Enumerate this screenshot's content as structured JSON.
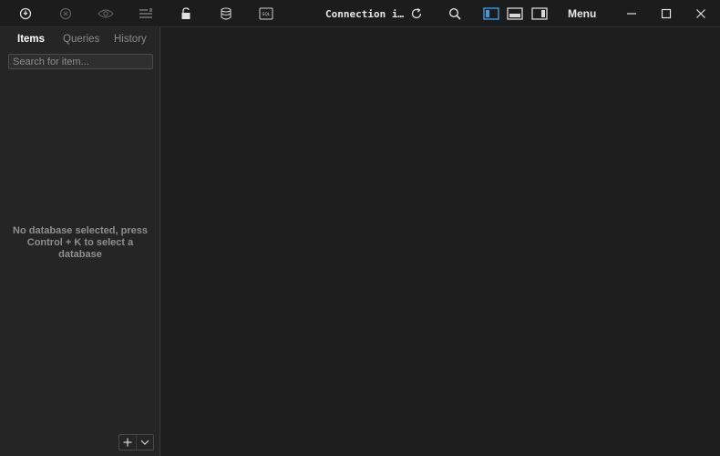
{
  "toolbar": {
    "icons": [
      "connect-icon",
      "close-connection-icon",
      "preview-icon",
      "console-icon",
      "lock-icon",
      "database-icon",
      "sql-icon",
      "refresh-icon",
      "search-icon",
      "layout-left-icon",
      "layout-bottom-icon",
      "layout-right-icon",
      "minimize-icon",
      "maximize-icon",
      "close-icon"
    ],
    "sql_text": "SQL",
    "connection_label": "Connection i…",
    "menu_label": "Menu",
    "accent_color": "#3a9be0"
  },
  "sidebar": {
    "tabs": [
      {
        "label": "Items",
        "active": true
      },
      {
        "label": "Queries",
        "active": false
      },
      {
        "label": "History",
        "active": false
      }
    ],
    "search": {
      "placeholder": "Search for item...",
      "value": ""
    },
    "empty_message": "No database selected, press Control + K to select a database",
    "add_icon": "plus-icon",
    "dropdown_icon": "chevron-down-icon"
  }
}
